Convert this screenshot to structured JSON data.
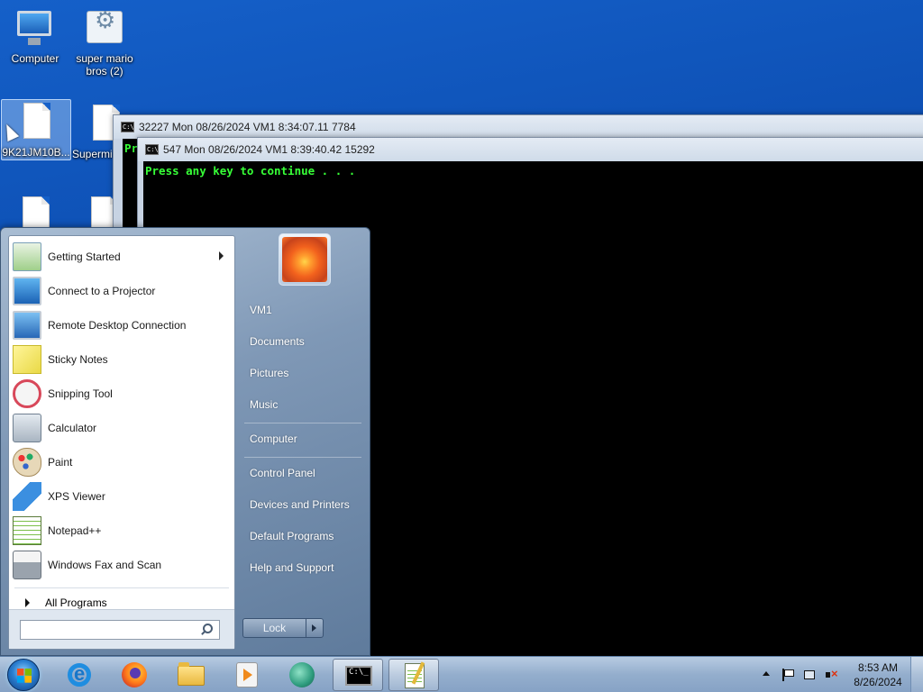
{
  "desktop": {
    "icons": [
      {
        "label": "Computer",
        "icon": "computer-icon"
      },
      {
        "label": "super mario bros (2)",
        "icon": "settings-file-icon"
      },
      {
        "label": "9K21JM10B...",
        "icon": "document-icon"
      },
      {
        "label": "Supermi",
        "icon": "document-icon"
      }
    ]
  },
  "console_back": {
    "title": "32227 Mon 08/26/2024 VM1  8:34:07.11 7784",
    "partial_text": "Pr"
  },
  "console_front": {
    "title": "547 Mon 08/26/2024 VM1  8:39:40.42 15292",
    "output": "Press any key to continue . . ."
  },
  "start_menu": {
    "programs": [
      {
        "label": "Getting Started",
        "icon": "getting-started-icon",
        "has_submenu": true
      },
      {
        "label": "Connect to a Projector",
        "icon": "projector-icon"
      },
      {
        "label": "Remote Desktop Connection",
        "icon": "remote-desktop-icon"
      },
      {
        "label": "Sticky Notes",
        "icon": "sticky-notes-icon"
      },
      {
        "label": "Snipping Tool",
        "icon": "snipping-tool-icon"
      },
      {
        "label": "Calculator",
        "icon": "calculator-icon"
      },
      {
        "label": "Paint",
        "icon": "paint-icon"
      },
      {
        "label": "XPS Viewer",
        "icon": "xps-viewer-icon"
      },
      {
        "label": "Notepad++",
        "icon": "notepad-plus-plus-icon"
      },
      {
        "label": "Windows Fax and Scan",
        "icon": "fax-scan-icon"
      }
    ],
    "all_programs_label": "All Programs",
    "search": {
      "value": "",
      "placeholder": ""
    },
    "right_items": {
      "user": "VM1",
      "documents": "Documents",
      "pictures": "Pictures",
      "music": "Music",
      "computer": "Computer",
      "control_panel": "Control Panel",
      "devices": "Devices and Printers",
      "default_programs": "Default Programs",
      "help": "Help and Support"
    },
    "lock_label": "Lock"
  },
  "taskbar": {
    "pinned": [
      "start-orb-icon",
      "internet-explorer-icon",
      "firefox-icon",
      "windows-explorer-icon",
      "media-player-icon",
      "app-fish-icon",
      "command-prompt-icon",
      "notepad-plus-plus-icon"
    ],
    "clock": {
      "time": "8:53 AM",
      "date": "8/26/2024"
    }
  }
}
